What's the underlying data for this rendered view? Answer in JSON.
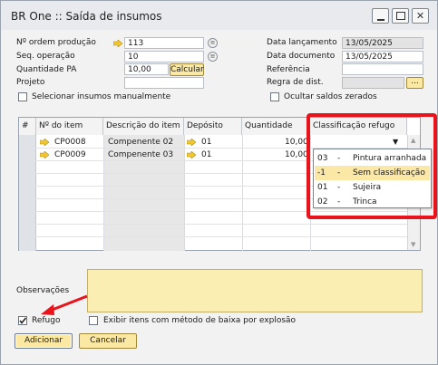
{
  "window": {
    "title": "BR One :: Saída de insumos"
  },
  "header": {
    "ordem_label": "Nº ordem produção",
    "ordem_value": "113",
    "seq_label": "Seq. operação",
    "seq_value": "10",
    "qtd_label": "Quantidade PA",
    "qtd_value": "10,00",
    "calcular_label": "Calcular",
    "projeto_label": "Projeto",
    "projeto_value": "",
    "selecionar_label": "Selecionar insumos manualmente",
    "data_lanc_label": "Data lançamento",
    "data_lanc_value": "13/05/2025",
    "data_doc_label": "Data documento",
    "data_doc_value": "13/05/2025",
    "referencia_label": "Referência",
    "referencia_value": "",
    "regra_label": "Regra de dist.",
    "regra_value": "",
    "regra_btn_label": "...",
    "ocultar_label": "Ocultar saldos zerados"
  },
  "grid": {
    "columns": [
      "#",
      "Nº do item",
      "Descrição do item",
      "Depósito",
      "Quantidade",
      "Classificação refugo"
    ],
    "rows": [
      {
        "item": "CP0008",
        "descricao": "Compenente 02",
        "deposito": "01",
        "quantidade": "10,00"
      },
      {
        "item": "CP0009",
        "descricao": "Compenente 03",
        "deposito": "01",
        "quantidade": "10,00"
      }
    ]
  },
  "dropdown": {
    "options": [
      {
        "code": "03",
        "dash": "-",
        "label": "Pintura arranhada",
        "selected": false
      },
      {
        "code": "-1",
        "dash": "-",
        "label": "Sem classificação",
        "selected": true
      },
      {
        "code": "01",
        "dash": "-",
        "label": "Sujeira",
        "selected": false
      },
      {
        "code": "02",
        "dash": "-",
        "label": "Trinca",
        "selected": false
      }
    ]
  },
  "footer": {
    "observacoes_label": "Observações",
    "observacoes_value": "",
    "refugo_label": "Refugo",
    "refugo_checked": true,
    "explosao_label": "Exibir itens com método de baixa por explosão",
    "adicionar_label": "Adicionar",
    "cancelar_label": "Cancelar"
  },
  "colors": {
    "accent_yellow": "#fbe9a3",
    "highlight_red": "#e8131b",
    "arrow_yellow": "#f2c830"
  },
  "icons": {
    "link_arrow": "yellow-arrow-icon",
    "info": "info-circle-icon"
  }
}
